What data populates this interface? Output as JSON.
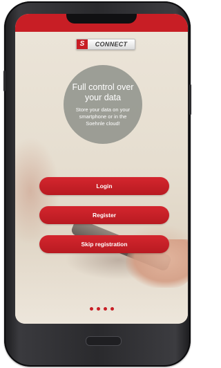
{
  "brand": {
    "logo_mark": "S",
    "logo_text": "CONNECT",
    "accent_color": "#c81e25"
  },
  "hero": {
    "title": "Full control over your data",
    "subtitle": "Store your data on your smartphone or in the Soehnle cloud!"
  },
  "actions": {
    "login_label": "Login",
    "register_label": "Register",
    "skip_label": "Skip registration"
  },
  "pager": {
    "page_count": 4
  },
  "device": {
    "home_button_icon": "home-button-icon"
  }
}
